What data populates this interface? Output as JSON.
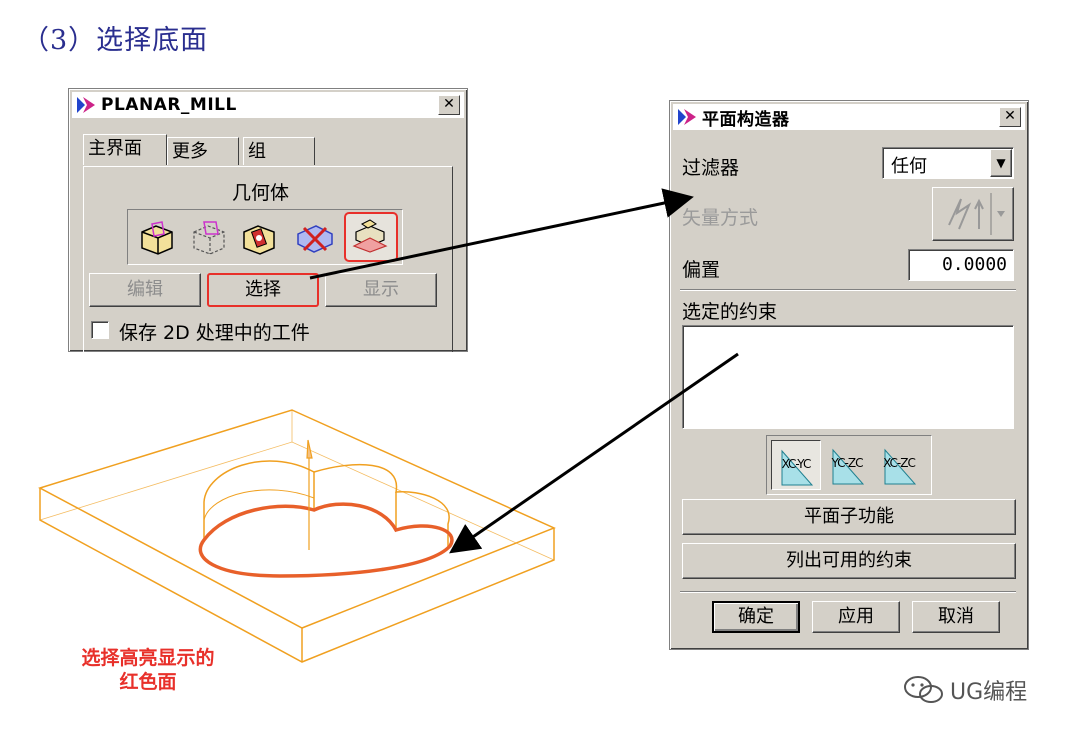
{
  "heading": "（3）选择底面",
  "planar_mill": {
    "title": "PLANAR_MILL",
    "tabs": [
      "主界面",
      "更多",
      "组"
    ],
    "section_label": "几何体",
    "buttons": {
      "edit": "编辑",
      "select": "选择",
      "display": "显示"
    },
    "checkbox_label": "保存 2D 处理中的工件",
    "geometry_icons": [
      "part-geometry-icon",
      "blank-geometry-icon",
      "check-geometry-icon",
      "trim-geometry-icon",
      "floor-geometry-icon"
    ]
  },
  "plane_constructor": {
    "title": "平面构造器",
    "filter_label": "过滤器",
    "filter_value": "任何",
    "vector_method_label": "矢量方式",
    "offset_label": "偏置",
    "offset_value": "0.0000",
    "selected_constraints_label": "选定的约束",
    "plane_buttons": [
      "XC-YC",
      "YC-ZC",
      "XC-ZC"
    ],
    "plane_subfunction": "平面子功能",
    "list_constraints": "列出可用的约束",
    "ok": "确定",
    "apply": "应用",
    "cancel": "取消"
  },
  "caption": [
    "选择高亮显示的",
    "红色面"
  ],
  "watermark": "UG编程",
  "colors": {
    "highlight": "#e8302a",
    "model_edge": "#f0a020",
    "heading": "#2a2e8f"
  }
}
